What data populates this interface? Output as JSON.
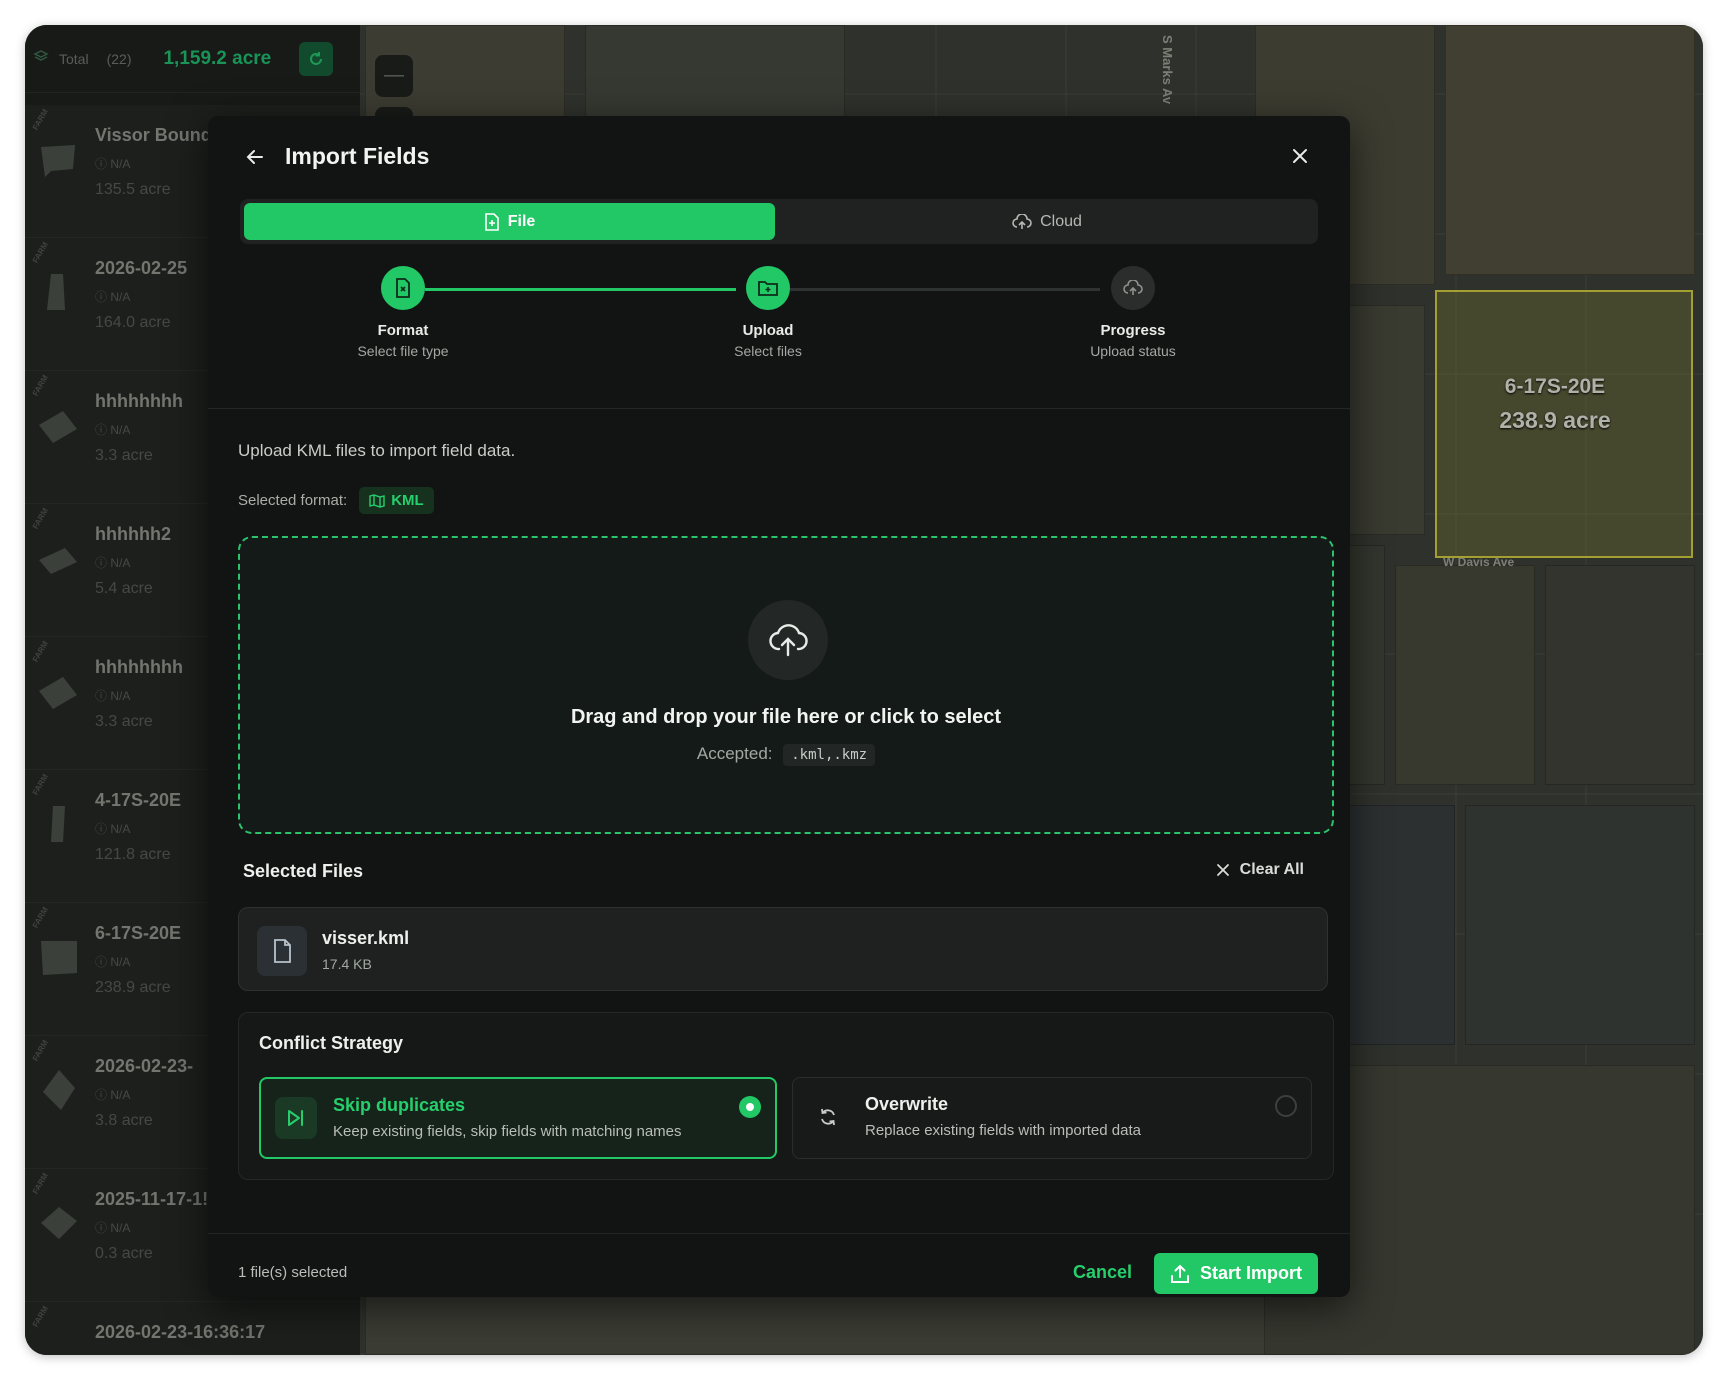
{
  "sidebar": {
    "total_label": "Total",
    "total_count": "(22)",
    "total_value": "1,159.2 acre",
    "farm_tag": "FARM",
    "items": [
      {
        "name": "Vissor Bound",
        "meta": "N/A",
        "acre": "135.5 acre"
      },
      {
        "name": "2026-02-25",
        "meta": "N/A",
        "acre": "164.0 acre"
      },
      {
        "name": "hhhhhhhh",
        "meta": "N/A",
        "acre": "3.3 acre"
      },
      {
        "name": "hhhhhh2",
        "meta": "N/A",
        "acre": "5.4 acre"
      },
      {
        "name": "hhhhhhhh",
        "meta": "N/A",
        "acre": "3.3 acre"
      },
      {
        "name": "4-17S-20E",
        "meta": "N/A",
        "acre": "121.8 acre"
      },
      {
        "name": "6-17S-20E",
        "meta": "N/A",
        "acre": "238.9 acre"
      },
      {
        "name": "2026-02-23-",
        "meta": "N/A",
        "acre": "3.8 acre"
      },
      {
        "name": "2025-11-17-1!",
        "meta": "N/A",
        "acre": "0.3 acre"
      },
      {
        "name": "2026-02-23-16:36:17",
        "meta": "N/A",
        "acre": ""
      }
    ]
  },
  "map": {
    "road_labels": [
      "S Marks Av",
      "W Davis Ave"
    ],
    "field_label": "6-17S-20E",
    "field_acre": "238.9 acre",
    "zoom_out": "—"
  },
  "modal": {
    "title": "Import Fields",
    "tabs": {
      "file": "File",
      "cloud": "Cloud"
    },
    "steps": [
      {
        "label": "Format",
        "sub": "Select file type"
      },
      {
        "label": "Upload",
        "sub": "Select files"
      },
      {
        "label": "Progress",
        "sub": "Upload status"
      }
    ],
    "intro": "Upload KML files to import field data.",
    "format_label": "Selected format:",
    "format_value": "KML",
    "dropzone": {
      "title": "Drag and drop your file here or click to select",
      "accepted_label": "Accepted:",
      "accepted_value": ".kml,.kmz"
    },
    "selected_files_title": "Selected Files",
    "clear_all": "Clear All",
    "files": [
      {
        "name": "visser.kml",
        "size": "17.4 KB"
      }
    ],
    "conflict": {
      "title": "Conflict Strategy",
      "skip": {
        "title": "Skip duplicates",
        "desc": "Keep existing fields, skip fields with matching names"
      },
      "overwrite": {
        "title": "Overwrite",
        "desc": "Replace existing fields with imported data"
      }
    },
    "footer": {
      "selected_count": "1 file(s) selected",
      "cancel": "Cancel",
      "start": "Start Import"
    }
  },
  "colors": {
    "accent": "#22c766",
    "modal_bg": "#121413",
    "sidebar_bg": "#1d201d"
  }
}
